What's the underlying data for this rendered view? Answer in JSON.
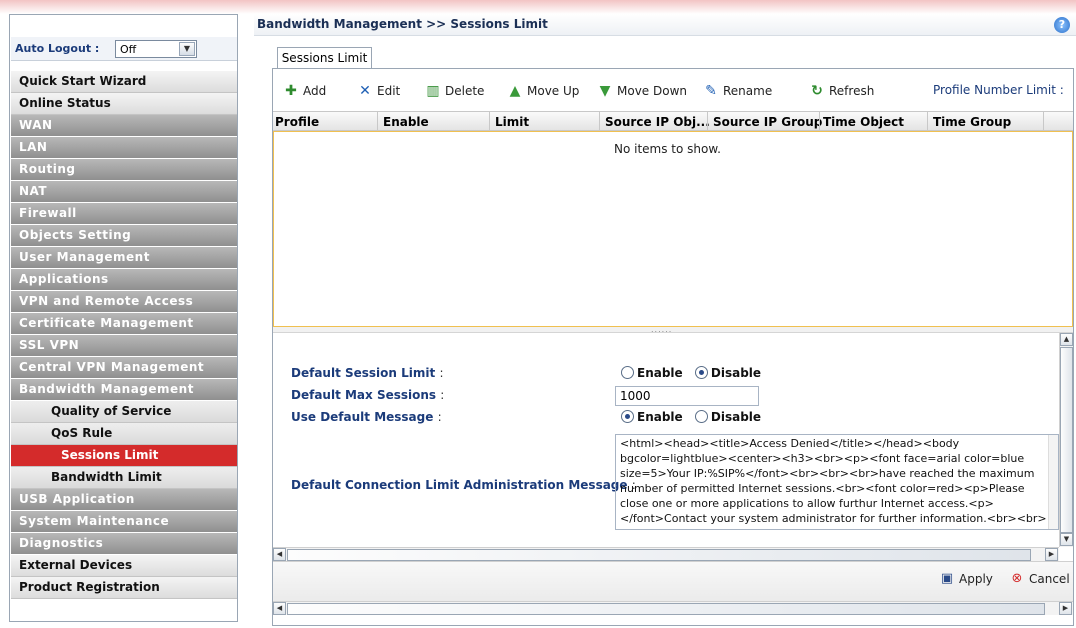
{
  "sidebar": {
    "auto_logout_label": "Auto Logout :",
    "auto_logout_value": "Off",
    "items": [
      {
        "label": "Quick Start Wizard",
        "style": "light"
      },
      {
        "label": "Online Status",
        "style": "light"
      },
      {
        "label": "WAN",
        "style": "dark"
      },
      {
        "label": "LAN",
        "style": "dark"
      },
      {
        "label": "Routing",
        "style": "dark"
      },
      {
        "label": "NAT",
        "style": "dark"
      },
      {
        "label": "Firewall",
        "style": "dark"
      },
      {
        "label": "Objects Setting",
        "style": "dark"
      },
      {
        "label": "User Management",
        "style": "dark"
      },
      {
        "label": "Applications",
        "style": "dark"
      },
      {
        "label": "VPN and Remote Access",
        "style": "dark"
      },
      {
        "label": "Certificate Management",
        "style": "dark"
      },
      {
        "label": "SSL VPN",
        "style": "dark"
      },
      {
        "label": "Central VPN Management",
        "style": "dark"
      },
      {
        "label": "Bandwidth Management",
        "style": "dark"
      },
      {
        "label": "Quality of Service",
        "style": "sub"
      },
      {
        "label": "QoS Rule",
        "style": "sub"
      },
      {
        "label": "Sessions Limit",
        "style": "sub-active"
      },
      {
        "label": "Bandwidth Limit",
        "style": "sub"
      },
      {
        "label": "USB Application",
        "style": "dark"
      },
      {
        "label": "System Maintenance",
        "style": "dark"
      },
      {
        "label": "Diagnostics",
        "style": "dark"
      },
      {
        "label": "External Devices",
        "style": "light"
      },
      {
        "label": "Product Registration",
        "style": "light"
      }
    ]
  },
  "header": {
    "breadcrumb": "Bandwidth Management >> Sessions Limit",
    "help_icon": "?"
  },
  "tab": {
    "label": "Sessions Limit"
  },
  "toolbar": {
    "add": "Add",
    "edit": "Edit",
    "delete": "Delete",
    "move_up": "Move Up",
    "move_down": "Move Down",
    "rename": "Rename",
    "refresh": "Refresh",
    "profile_number_limit": "Profile Number Limit :"
  },
  "grid": {
    "columns": [
      "Profile",
      "Enable",
      "Limit",
      "Source IP Obj...",
      "Source IP Group",
      "Time Object",
      "Time Group"
    ],
    "empty_text": "No items to show."
  },
  "form": {
    "default_session_limit_label": "Default Session Limit",
    "default_max_sessions_label": "Default Max Sessions",
    "use_default_message_label": "Use Default Message",
    "default_conn_limit_msg_label": "Default Connection Limit Administration Message",
    "colon": ":",
    "enable": "Enable",
    "disable": "Disable",
    "default_session_limit_selected": "Disable",
    "use_default_message_selected": "Enable",
    "default_max_sessions_value": "1000",
    "message_value": "<html><head><title>Access Denied</title></head><body bgcolor=lightblue><center><h3><br><p><font face=arial color=blue size=5>Your IP:%SIP%</font><br><br><br>have reached the maximum number of permitted Internet sessions.<br><font color=red><p>Please close one or more applications to allow furthur Internet access.<p></font>Contact your system administrator for further information.<br><br></center></body></html>"
  },
  "footer": {
    "apply": "Apply",
    "cancel": "Cancel"
  },
  "colors": {
    "active_menu": "#d42b2b",
    "dark_menu": "#9a9a9a",
    "label_blue": "#1b3b7a",
    "grid_border": "#f0c050"
  }
}
